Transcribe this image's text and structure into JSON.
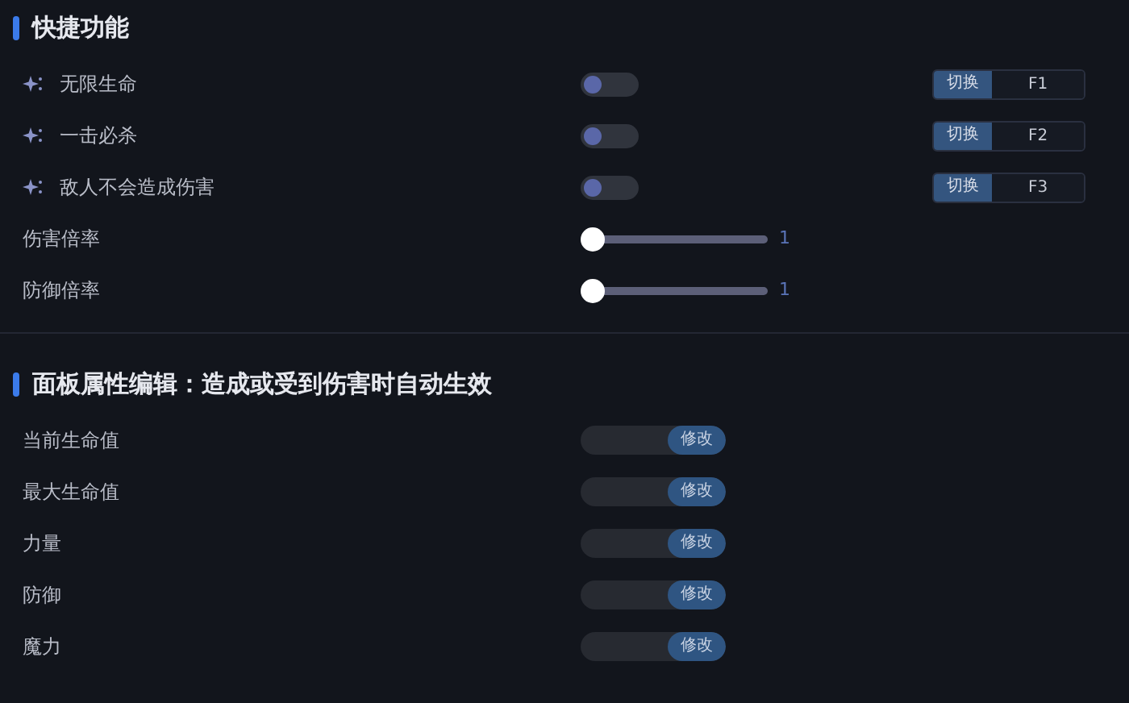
{
  "sections": [
    {
      "title": "快捷功能",
      "rows": [
        {
          "kind": "toggle",
          "label": "无限生命",
          "on": false,
          "hotkey_button": "切换",
          "hotkey": "F1"
        },
        {
          "kind": "toggle",
          "label": "一击必杀",
          "on": false,
          "hotkey_button": "切换",
          "hotkey": "F2"
        },
        {
          "kind": "toggle",
          "label": "敌人不会造成伤害",
          "on": false,
          "hotkey_button": "切换",
          "hotkey": "F3"
        },
        {
          "kind": "slider",
          "label": "伤害倍率",
          "level": 0,
          "reading": "1"
        },
        {
          "kind": "slider",
          "label": "防御倍率",
          "level": 0,
          "reading": "1"
        }
      ]
    },
    {
      "title": "面板属性编辑：造成或受到伤害时自动生效",
      "rows": [
        {
          "kind": "input",
          "label": "当前生命值",
          "button": "修改"
        },
        {
          "kind": "input",
          "label": "最大生命值",
          "button": "修改"
        },
        {
          "kind": "input",
          "label": "力量",
          "button": "修改"
        },
        {
          "kind": "input",
          "label": "防御",
          "button": "修改"
        },
        {
          "kind": "input",
          "label": "魔力",
          "button": "修改"
        }
      ]
    }
  ]
}
